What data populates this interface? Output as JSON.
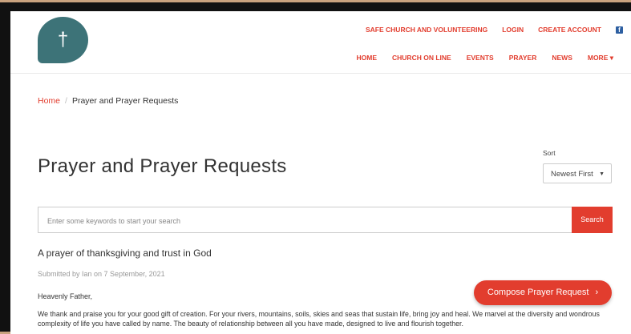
{
  "header": {
    "logo_glyph": "†",
    "top_links": [
      "SAFE CHURCH AND VOLUNTEERING",
      "LOGIN",
      "CREATE ACCOUNT"
    ],
    "facebook_glyph": "f",
    "main_nav": [
      "HOME",
      "CHURCH ON LINE",
      "EVENTS",
      "PRAYER",
      "NEWS",
      "MORE ▾"
    ]
  },
  "breadcrumb": {
    "home": "Home",
    "separator": "/",
    "current": "Prayer and Prayer Requests"
  },
  "page": {
    "title": "Prayer and Prayer Requests",
    "sort_label": "Sort",
    "sort_value": "Newest First",
    "sort_caret": "▼"
  },
  "search": {
    "placeholder": "Enter some keywords to start your search",
    "button": "Search"
  },
  "post": {
    "title": "A prayer of thanksgiving and trust in God",
    "meta": "Submitted by Ian on 7 September, 2021",
    "greeting": "Heavenly Father,",
    "body": "We thank and praise you for your good gift of creation. For your rivers, mountains, soils, skies and seas that sustain life, bring joy and heal. We marvel at the diversity and wondrous complexity of life you have called by name. The beauty of relationship between all you have made, designed to live and flourish together."
  },
  "compose": {
    "label": "Compose Prayer Request",
    "chevron": "›"
  },
  "colors": {
    "accent": "#e23d2e",
    "logo": "#3d7378"
  }
}
